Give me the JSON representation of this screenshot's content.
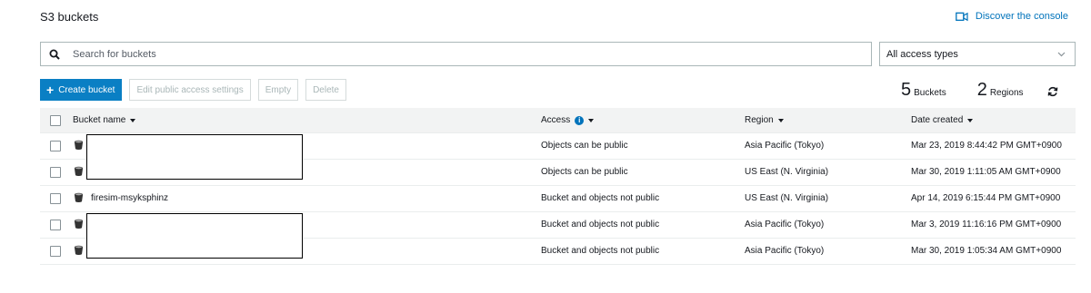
{
  "header": {
    "title": "S3 buckets",
    "discover_label": "Discover the console"
  },
  "search": {
    "placeholder": "Search for buckets",
    "value": ""
  },
  "filter": {
    "selected": "All access types"
  },
  "toolbar": {
    "create_label": "Create bucket",
    "edit_label": "Edit public access settings",
    "empty_label": "Empty",
    "delete_label": "Delete"
  },
  "stats": {
    "buckets_count": "5",
    "buckets_label": "Buckets",
    "regions_count": "2",
    "regions_label": "Regions"
  },
  "table": {
    "columns": {
      "name": "Bucket name",
      "access": "Access",
      "region": "Region",
      "date": "Date created"
    },
    "rows": [
      {
        "name": "",
        "access": "Objects can be public",
        "region": "Asia Pacific (Tokyo)",
        "date": "Mar 23, 2019 8:44:42 PM GMT+0900"
      },
      {
        "name": "",
        "access": "Objects can be public",
        "region": "US East (N. Virginia)",
        "date": "Mar 30, 2019 1:11:05 AM GMT+0900"
      },
      {
        "name": "firesim-msyksphinz",
        "access": "Bucket and objects not public",
        "region": "US East (N. Virginia)",
        "date": "Apr 14, 2019 6:15:44 PM GMT+0900"
      },
      {
        "name": "",
        "access": "Bucket and objects not public",
        "region": "Asia Pacific (Tokyo)",
        "date": "Mar 3, 2019 11:16:16 PM GMT+0900"
      },
      {
        "name": "",
        "access": "Bucket and objects not public",
        "region": "Asia Pacific (Tokyo)",
        "date": "Mar 30, 2019 1:05:34 AM GMT+0900"
      }
    ]
  },
  "icons": {
    "search": "search-icon",
    "discover": "video-camera-icon",
    "chevron": "chevron-down-icon",
    "refresh": "refresh-icon",
    "bucket": "bucket-icon",
    "info": "info-icon"
  },
  "colors": {
    "accent": "#0073bb",
    "primary_button": "#0a7fc4",
    "header_bg": "#f2f3f3",
    "disabled_text": "#aab7b8"
  }
}
